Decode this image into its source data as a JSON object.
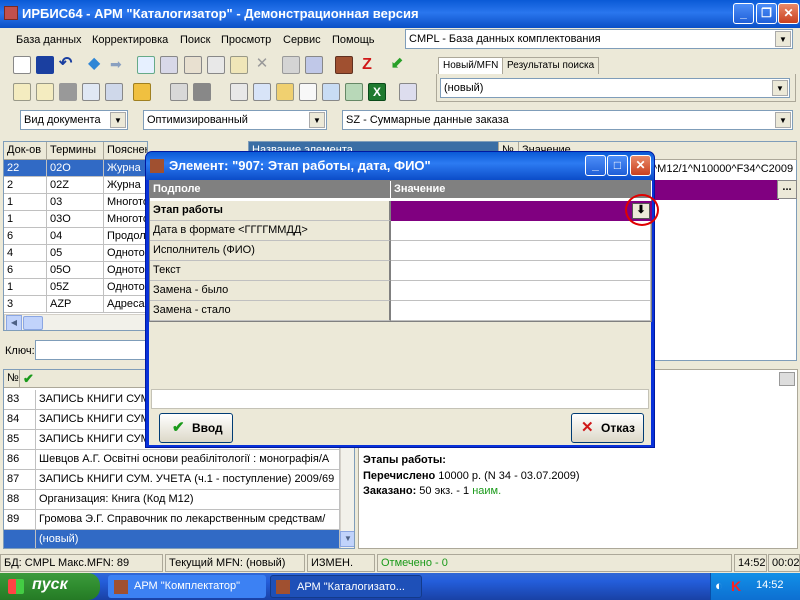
{
  "window": {
    "title": "ИРБИС64 - АРМ \"Каталогизатор\" - Демонстрационная версия"
  },
  "menu": [
    "База данных",
    "Корректировка",
    "Поиск",
    "Просмотр",
    "Сервис",
    "Помощь"
  ],
  "database_combo": {
    "value": "CMPL - База данных комплектования"
  },
  "tabs": [
    "Новый/MFN",
    "Результаты поиска"
  ],
  "new_mfn_combo": {
    "value": "(новый)"
  },
  "filter_row": {
    "doc_view": "Вид документа",
    "optimized": "Оптимизированный",
    "worksheet": "SZ - Суммарные данные заказа"
  },
  "dict_table": {
    "headers": [
      "Док-ов",
      "Термины",
      "Пояснен"
    ],
    "rows": [
      {
        "count": "22",
        "term": "02O",
        "note": "Журна",
        "selected": true
      },
      {
        "count": "2",
        "term": "02Z",
        "note": "Журна"
      },
      {
        "count": "1",
        "term": "03",
        "note": "Многото"
      },
      {
        "count": "1",
        "term": "03O",
        "note": "Многото"
      },
      {
        "count": "6",
        "term": "04",
        "note": "Продол"
      },
      {
        "count": "4",
        "term": "05",
        "note": "Одното"
      },
      {
        "count": "6",
        "term": "05O",
        "note": "Одното"
      },
      {
        "count": "1",
        "term": "05Z",
        "note": "Одното"
      },
      {
        "count": "3",
        "term": "AZP",
        "note": "Адреса"
      }
    ]
  },
  "key": {
    "label": "Ключ:"
  },
  "right_header": {
    "col1": "Название элемента",
    "col2": "№",
    "col3": "Значение"
  },
  "right_value_row": "^M12/1^N10000^F34^C2009",
  "records": {
    "headers": [
      "№"
    ],
    "rows": [
      {
        "num": "83",
        "text": "ЗАПИСЬ КНИГИ СУМ. УЧЕТА"
      },
      {
        "num": "84",
        "text": "ЗАПИСЬ КНИГИ СУМ. УЧЕТА"
      },
      {
        "num": "85",
        "text": "ЗАПИСЬ КНИГИ СУМ. УЧЕТА"
      },
      {
        "num": "86",
        "text": "Шевцов А.Г. Освітні основи реабілітології : монографія/А"
      },
      {
        "num": "87",
        "text": "ЗАПИСЬ КНИГИ СУМ. УЧЕТА (ч.1 - поступление)  2009/69"
      },
      {
        "num": "88",
        "text": "Организация: Книга (Код М12)"
      },
      {
        "num": "89",
        "text": "Громова Э.Г. Справочник по лекарственным средствам/"
      },
      {
        "num": "",
        "text": "(новый)",
        "selected": true
      }
    ]
  },
  "info_panel": {
    "stages_label": "Этапы работы:",
    "line1_bold": "Перечислено",
    "line1_rest": " 10000 р. (N 34 - 03.07.2009)",
    "line2_bold": "Заказано:",
    "line2_rest": " 50 экз. - 1 ",
    "line2_green": "наим."
  },
  "dialog": {
    "title": "Элемент: \"907: Этап работы, дата, ФИО\"",
    "col_sub": "Подполе",
    "col_val": "Значение",
    "rows": [
      "Этап работы",
      "Дата в формате <ГГГГММДД>",
      "Исполнитель (ФИО)",
      "Текст",
      "Замена - было",
      "Замена - стало"
    ],
    "ok": "Ввод",
    "cancel": "Отказ"
  },
  "status": {
    "db": "БД: CMPL Макс.MFN: 89",
    "mfn": "Текущий MFN: (новый)",
    "changed": "ИЗМЕН.",
    "marked": "Отмечено - 0",
    "time1": "14:52",
    "time2": "00:02"
  },
  "taskbar": {
    "start": "пуск",
    "tasks": [
      "АРМ \"Комплектатор\"",
      "АРМ \"Каталогизато..."
    ],
    "clock": "14:52"
  },
  "colors": {
    "accent_purple": "#800080",
    "xp_blue": "#0a5ad6",
    "highlight_circle": "#e00000",
    "green_check": "#1a9a1a"
  }
}
